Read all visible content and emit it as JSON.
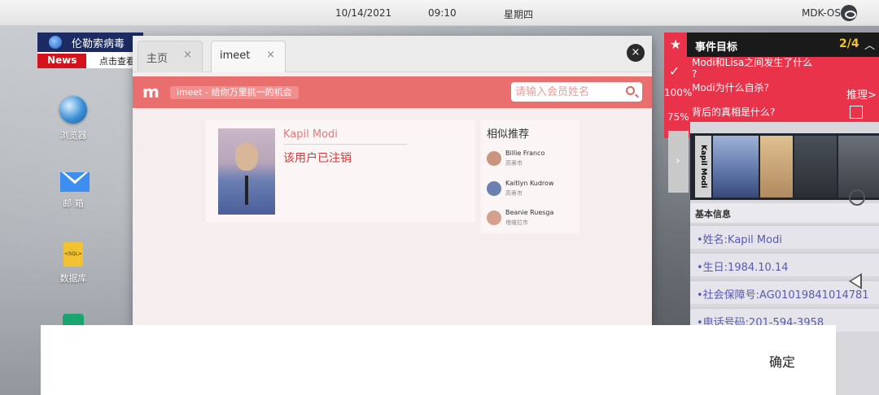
{
  "statusbar": {
    "date": "10/14/2021",
    "time": "09:10",
    "weekday": "星期四",
    "os_name": "MDK-OS"
  },
  "news": {
    "headline": "伦勒索病毒",
    "label": "News",
    "more": "点击查看"
  },
  "desktop_icons": [
    {
      "label": "浏览器",
      "icon": "globe-icon"
    },
    {
      "label": "邮 箱",
      "icon": "mail-icon"
    },
    {
      "label": "数据库",
      "icon": "sql-file-icon"
    }
  ],
  "browser": {
    "tabs": [
      {
        "label": "主页",
        "close": "×"
      },
      {
        "label": "imeet",
        "close": "×"
      }
    ],
    "close_icon": "×",
    "app": {
      "logo": "m",
      "slogan": "imeet - 给你万里挑一的机会",
      "search_placeholder": "请输入会员姓名"
    },
    "profile": {
      "name": "Kapil Modi",
      "status": "该用户已注销"
    },
    "similar": {
      "title": "相似推荐",
      "items": [
        {
          "name": "Billie Franco",
          "city": "高蒂市",
          "color": "#c9957c"
        },
        {
          "name": "Kaitlyn Kudrow",
          "city": "高蒂市",
          "color": "#6b7fb0"
        },
        {
          "name": "Beanie Ruesga",
          "city": "塔维拉市",
          "color": "#d6a08e"
        }
      ]
    }
  },
  "events": {
    "title": "事件目标",
    "count": "2/4",
    "goals": [
      {
        "text": "Modi和Lisa之间发生了什么",
        "text2": "?",
        "marker": "✓"
      },
      {
        "text": "Modi为什么自杀?",
        "percent": "100%"
      },
      {
        "text": "背后的真相是什么?",
        "percent": "75%"
      }
    ],
    "infer_link": "推理>",
    "side_arrow": "›"
  },
  "dossier": {
    "name": "Kapil Modi",
    "section": "基本信息",
    "rows": [
      "•姓名:Kapil Modi",
      "•生日:1984.10.14",
      "•社会保障号:AG010198410147​81",
      "•电话号码:201-594-3958"
    ]
  },
  "dialog": {
    "confirm": "确定"
  },
  "colors": {
    "accent": "#e96e6e",
    "event_red": "#e8334a"
  }
}
